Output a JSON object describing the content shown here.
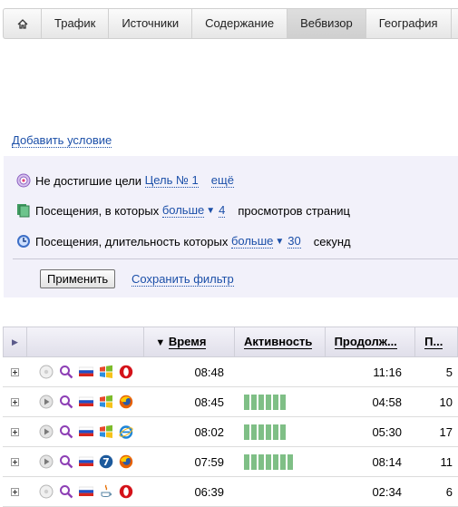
{
  "tabs": [
    {
      "label": "Трафик"
    },
    {
      "label": "Источники"
    },
    {
      "label": "Содержание"
    },
    {
      "label": "Вебвизор",
      "active": true
    },
    {
      "label": "География"
    }
  ],
  "filter": {
    "add_condition": "Добавить условие",
    "goal_row": {
      "text": "Не достигшие цели",
      "goal": "Цель № 1",
      "more": "ещё"
    },
    "pages_row": {
      "text": "Посещения, в которых",
      "op": "больше",
      "value": "4",
      "suffix": "просмотров страниц"
    },
    "duration_row": {
      "text": "Посещения, длительность которых",
      "op": "больше",
      "value": "30",
      "suffix": "секунд"
    },
    "apply_label": "Применить",
    "save_label": "Сохранить фильтр"
  },
  "table": {
    "headers": {
      "time": "Время",
      "activity": "Активность",
      "duration": "Продолж...",
      "pages": "П..."
    },
    "sort_arrow": "▼",
    "rows": [
      {
        "time": "08:48",
        "duration": "11:16",
        "pages": "5",
        "activity": 0,
        "played": false,
        "os": "windows",
        "browser": "opera"
      },
      {
        "time": "08:45",
        "duration": "04:58",
        "pages": "10",
        "activity": 6,
        "played": true,
        "os": "windows",
        "browser": "firefox"
      },
      {
        "time": "08:02",
        "duration": "05:30",
        "pages": "17",
        "activity": 6,
        "played": true,
        "os": "windows",
        "browser": "ie"
      },
      {
        "time": "07:59",
        "duration": "08:14",
        "pages": "11",
        "activity": 7,
        "played": true,
        "os": "windows7",
        "browser": "firefox"
      },
      {
        "time": "06:39",
        "duration": "02:34",
        "pages": "6",
        "activity": 0,
        "played": false,
        "os": "java",
        "browser": "opera"
      }
    ]
  },
  "colors": {
    "link": "#1b4fa8",
    "activity_bar": "#7fbf86",
    "filter_bg": "#f2f1fa"
  }
}
